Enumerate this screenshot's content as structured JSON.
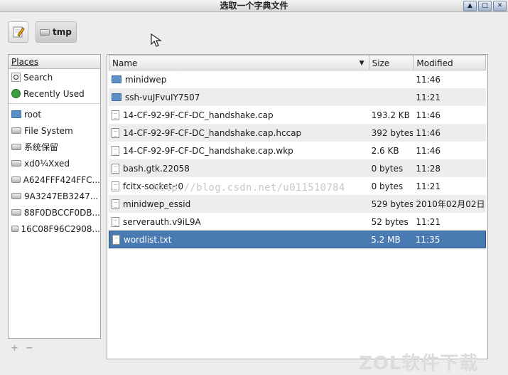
{
  "window": {
    "title": "选取一个字典文件",
    "buttons": [
      "▲",
      "□",
      "✕"
    ]
  },
  "toolbar": {
    "path_label": "tmp"
  },
  "places": {
    "header": "Places",
    "items": [
      {
        "label": "Search",
        "icon": "search-icon"
      },
      {
        "label": "Recently Used",
        "icon": "recent-icon"
      },
      {
        "label": "root",
        "icon": "folder-icon"
      },
      {
        "label": "File System",
        "icon": "drive-icon"
      },
      {
        "label": "系统保留",
        "icon": "drive-icon"
      },
      {
        "label": "xd0¼Xxed",
        "icon": "drive-icon"
      },
      {
        "label": "A624FFF424FFC...",
        "icon": "drive-icon"
      },
      {
        "label": "9A3247EB3247...",
        "icon": "drive-icon"
      },
      {
        "label": "88F0DBCCF0DB...",
        "icon": "drive-icon"
      },
      {
        "label": "16C08F96C2908...",
        "icon": "drive-icon"
      }
    ],
    "add_label": "+",
    "remove_label": "−"
  },
  "files": {
    "columns": {
      "name": "Name",
      "size": "Size",
      "modified": "Modified"
    },
    "rows": [
      {
        "name": "minidwep",
        "size": "",
        "modified": "11:46",
        "type": "folder"
      },
      {
        "name": "ssh-vuJFvuIY7507",
        "size": "",
        "modified": "11:21",
        "type": "folder"
      },
      {
        "name": "14-CF-92-9F-CF-DC_handshake.cap",
        "size": "193.2 KB",
        "modified": "11:46",
        "type": "file"
      },
      {
        "name": "14-CF-92-9F-CF-DC_handshake.cap.hccap",
        "size": "392 bytes",
        "modified": "11:46",
        "type": "file"
      },
      {
        "name": "14-CF-92-9F-CF-DC_handshake.cap.wkp",
        "size": "2.6 KB",
        "modified": "11:46",
        "type": "file"
      },
      {
        "name": "bash.gtk.22058",
        "size": "0 bytes",
        "modified": "11:28",
        "type": "file"
      },
      {
        "name": "fcitx-socket-:0",
        "size": "0 bytes",
        "modified": "11:21",
        "type": "file"
      },
      {
        "name": "minidwep_essid",
        "size": "529 bytes",
        "modified": "2010年02月02日",
        "type": "file"
      },
      {
        "name": "serverauth.v9iL9A",
        "size": "52 bytes",
        "modified": "11:21",
        "type": "file"
      },
      {
        "name": "wordlist.txt",
        "size": "5.2 MB",
        "modified": "11:35",
        "type": "file",
        "selected": true
      }
    ]
  },
  "watermark": "http://blog.csdn.net/u011510784",
  "brand_watermark": "ZOL软件下载",
  "colors": {
    "selection": "#4a7ab2",
    "folder": "#5b8fc6"
  }
}
